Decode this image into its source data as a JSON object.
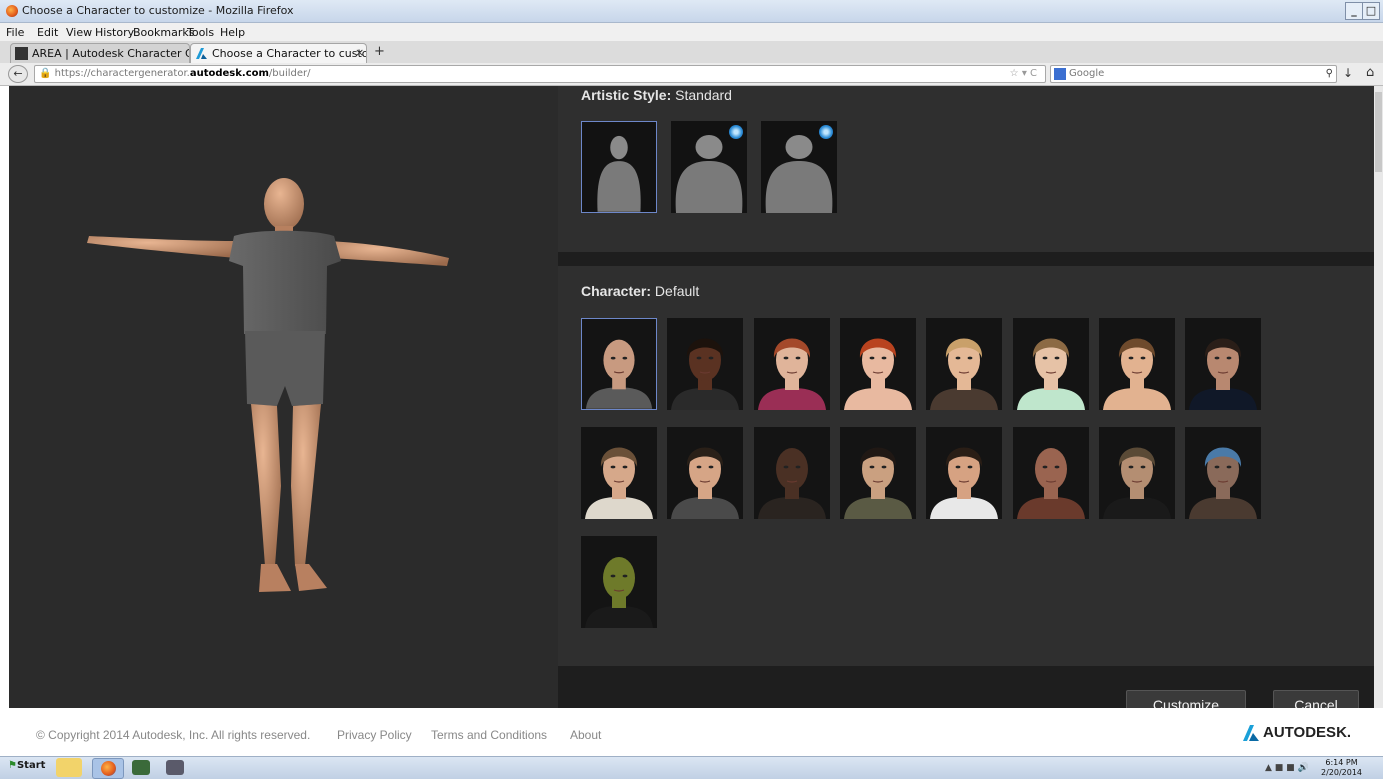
{
  "window": {
    "title": "Choose a Character to customize - Mozilla Firefox"
  },
  "menu": [
    "File",
    "Edit",
    "View",
    "History",
    "Bookmarks",
    "Tools",
    "Help"
  ],
  "tabs": [
    {
      "label": "AREA | Autodesk Character Generator..."
    },
    {
      "label": "Choose a Character to customize"
    }
  ],
  "nav": {
    "url_prefix": "https://charactergenerator.",
    "url_domain": "autodesk.com",
    "url_path": "/builder/",
    "search_placeholder": "Google"
  },
  "artistic_style": {
    "label": "Artistic Style:",
    "value": "Standard",
    "thumbs": [
      {
        "name": "standard",
        "selected": true,
        "badge": false
      },
      {
        "name": "muscular",
        "selected": false,
        "badge": true
      },
      {
        "name": "creature",
        "selected": false,
        "badge": true
      }
    ]
  },
  "character": {
    "label": "Character:",
    "value": "Default",
    "thumbs": [
      {
        "skin": "#c89a80",
        "hair": "none",
        "shirt": "#5a5a5a",
        "selected": true
      },
      {
        "skin": "#5a3222",
        "hair": "#1c120c",
        "shirt": "#2a2a2a"
      },
      {
        "skin": "#e0b49a",
        "hair": "#a4492a",
        "shirt": "#9a2e55"
      },
      {
        "skin": "#e8b9a0",
        "hair": "#b9431f",
        "shirt": "#e8b9a0"
      },
      {
        "skin": "#e4b896",
        "hair": "#c9a06a",
        "shirt": "#4a3a30"
      },
      {
        "skin": "#e6c2a6",
        "hair": "#8c6a44",
        "shirt": "#bfe6cc"
      },
      {
        "skin": "#e2b290",
        "hair": "#6e4a2c",
        "shirt": "#e2b290"
      },
      {
        "skin": "#b88870",
        "hair": "#2a1e18",
        "shirt": "#101828"
      },
      {
        "skin": "#d6a88a",
        "hair": "#6a5038",
        "shirt": "#ded8cc"
      },
      {
        "skin": "#d6a586",
        "hair": "#2a2018",
        "shirt": "#4a4a4a"
      },
      {
        "skin": "#4a3024",
        "hair": "none",
        "shirt": "#2a2420"
      },
      {
        "skin": "#caa080",
        "hair": "#201814",
        "shirt": "#5a5a44"
      },
      {
        "skin": "#d6a282",
        "hair": "#2a1e16",
        "shirt": "#e8e8e8"
      },
      {
        "skin": "#9a6450",
        "hair": "none",
        "shirt": "#6a3a2c"
      },
      {
        "skin": "#b48e72",
        "hair": "#5a4a36",
        "shirt": "#1a1a1a"
      },
      {
        "skin": "#8a6a5a",
        "hair": "#4a7aa8",
        "shirt": "#4a3a30"
      },
      {
        "skin": "#6e7a2a",
        "hair": "none",
        "shirt": "#1a1a1a"
      }
    ]
  },
  "buttons": {
    "customize": "Customize",
    "cancel": "Cancel"
  },
  "footer": {
    "copyright": "© Copyright 2014 Autodesk, Inc. All rights reserved.",
    "privacy": "Privacy Policy",
    "terms": "Terms and Conditions",
    "about": "About",
    "brand": "AUTODESK."
  },
  "taskbar": {
    "start": "Start",
    "time": "6:14 PM",
    "date": "2/20/2014"
  }
}
